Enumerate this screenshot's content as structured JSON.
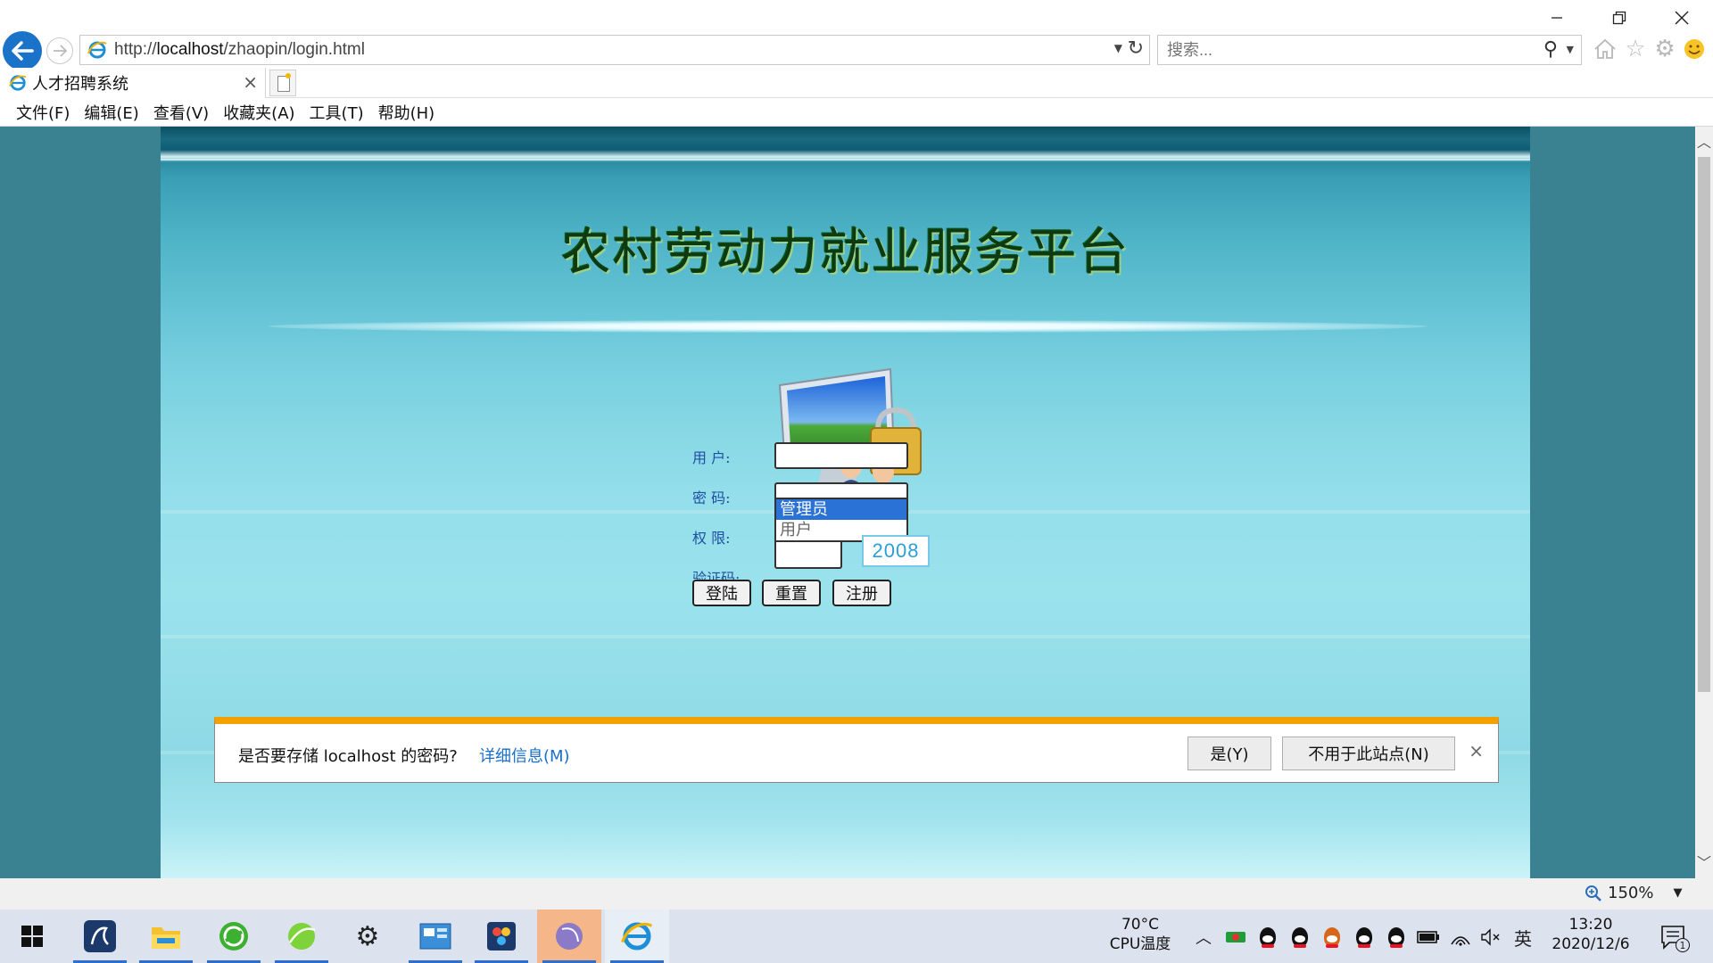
{
  "browser": {
    "url_prefix": "http://",
    "url_host": "localhost",
    "url_path": "/zhaopin/login.html",
    "search_placeholder": "搜索...",
    "tab_title": "人才招聘系统",
    "menu": [
      "文件(F)",
      "编辑(E)",
      "查看(V)",
      "收藏夹(A)",
      "工具(T)",
      "帮助(H)"
    ],
    "zoom_label": "150%"
  },
  "page": {
    "site_title": "农村劳动力就业服务平台",
    "form": {
      "username_label": "用  户:",
      "password_label": "密  码:",
      "role_label": "权  限:",
      "captcha_label": "验证码:",
      "role_options": [
        "管理员",
        "用户"
      ],
      "role_selected": "管理员",
      "captcha_code": "2008",
      "login_btn": "登陆",
      "reset_btn": "重置",
      "register_btn": "注册"
    }
  },
  "password_prompt": {
    "question": "是否要存储 localhost 的密码?",
    "more_info": "详细信息(M)",
    "yes_btn": "是(Y)",
    "never_btn": "不用于此站点(N)"
  },
  "taskbar": {
    "cpu_temp": "70°C",
    "cpu_label": "CPU温度",
    "ime": "英",
    "time": "13:20",
    "date": "2020/12/6",
    "notification_count": "1"
  },
  "colors": {
    "accent_blue": "#1a73c8",
    "warning_bar": "#f2a100",
    "label_blue": "#1f4fa0"
  }
}
